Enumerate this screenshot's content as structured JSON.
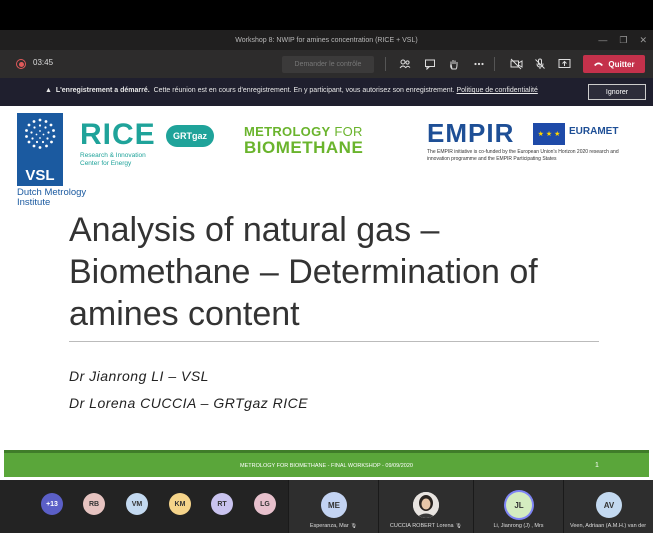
{
  "window": {
    "title": "Workshop 8: NWIP for amines concentration (RICE + VSL)",
    "controls": [
      "—",
      "❐",
      "✕"
    ]
  },
  "toolbar": {
    "timer": "03:45",
    "request_control_label": "Demander le contrôle",
    "quit_label": "Quitter"
  },
  "banner": {
    "bold_text": "L'enregistrement a démarré.",
    "text": "Cette réunion est en cours d'enregistrement. En y participant, vous autorisez son enregistrement.",
    "link": "Politique de confidentialité",
    "ignore_label": "Ignorer"
  },
  "slide": {
    "vsl": {
      "label": "VSL",
      "subtitle": "Dutch Metrology Institute"
    },
    "rice": {
      "word": "RICE",
      "grt": "GRTgaz",
      "subtitle_1": "Research & Innovation",
      "subtitle_2": "Center for Energy"
    },
    "mfb": {
      "line1_bold": "METROLOGY",
      "line1_normal": " FOR",
      "line2": "BIOMETHANE"
    },
    "empir": {
      "word": "EMPIR",
      "euramet": "EURAMET",
      "subtitle": "The EMPIR initiative is co-funded by the European Union's Horizon 2020 research and innovation programme and the EMPIR Participating States"
    },
    "title": "Analysis of natural gas – Biomethane – Determination of amines content",
    "authors": [
      "Dr Jianrong LI – VSL",
      "Dr Lorena CUCCIA – GRTgaz RICE"
    ],
    "footer": {
      "text": "METROLOGY FOR BIOMETHANE - FINAL WORKSHOP - 09/09/2020",
      "page": "1"
    }
  },
  "participants": {
    "overflow": "+13",
    "small": [
      {
        "initials": "RB",
        "color": "#e6c3c0"
      },
      {
        "initials": "VM",
        "color": "#c3d9f0"
      },
      {
        "initials": "KM",
        "color": "#f5d48a"
      },
      {
        "initials": "RT",
        "color": "#c9c3ef"
      },
      {
        "initials": "LG",
        "color": "#e7c0cc"
      }
    ],
    "tiles": [
      {
        "initials": "ME",
        "name": "Esperanza, Mar",
        "color": "#c3d3f2"
      },
      {
        "initials": "",
        "name": "CUCCIA ROBERT Lorena",
        "color": "#f0f0f0"
      },
      {
        "initials": "JL",
        "name": "Li, Jianrong (J) , Mrs",
        "color": "#d4ecc0"
      },
      {
        "initials": "AV",
        "name": "Veen, Adriaan (A.M.H.) van der",
        "color": "#c3d9f0"
      }
    ]
  },
  "colors": {
    "quit": "#c4314b",
    "slide_green": "#5aa63a",
    "vsl_blue": "#1b5aa0",
    "rice_teal": "#1fa39a"
  }
}
